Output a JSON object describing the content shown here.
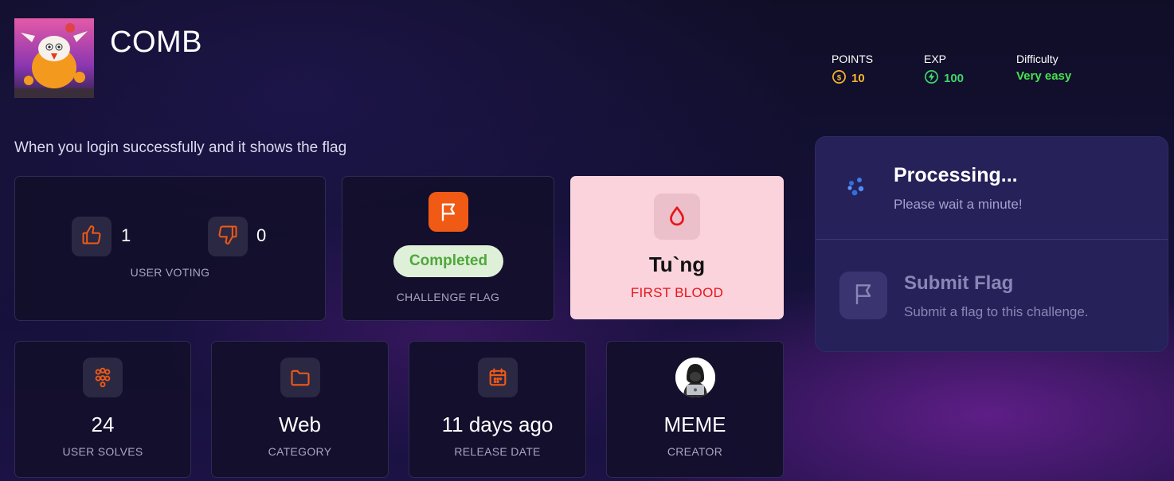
{
  "challenge": {
    "title": "COMB",
    "description": "When you login successfully and it shows the flag"
  },
  "stats": {
    "points_label": "POINTS",
    "points_value": "10",
    "exp_label": "EXP",
    "exp_value": "100",
    "difficulty_label": "Difficulty",
    "difficulty_value": "Very easy"
  },
  "voting": {
    "upvotes": "1",
    "downvotes": "0",
    "caption": "USER VOTING"
  },
  "flag": {
    "status": "Completed",
    "caption": "CHALLENGE FLAG"
  },
  "first_blood": {
    "name": "Tu`ng",
    "caption": "FIRST BLOOD"
  },
  "info_cards": {
    "solves_value": "24",
    "solves_caption": "USER SOLVES",
    "category_value": "Web",
    "category_caption": "CATEGORY",
    "release_value": "11 days ago",
    "release_caption": "RELEASE DATE",
    "creator_value": "MEME",
    "creator_caption": "CREATOR"
  },
  "panel": {
    "processing_title": "Processing...",
    "processing_sub": "Please wait a minute!",
    "submit_title": "Submit Flag",
    "submit_sub": "Submit a flag to this challenge."
  },
  "colors": {
    "accent_orange": "#f05a14",
    "points": "#f5b52e",
    "exp": "#3fd66a",
    "difficulty": "#47e04f",
    "first_blood_bg": "#fbd3dc",
    "first_blood_text": "#e8151c",
    "panel_bg": "#262159"
  },
  "icons": {
    "points": "coin-icon",
    "exp": "bolt-icon",
    "upvote": "thumbs-up-icon",
    "downvote": "thumbs-down-icon",
    "flag": "flag-icon",
    "blood": "drop-icon",
    "solves": "users-icon",
    "category": "folder-icon",
    "release": "calendar-icon",
    "processing": "spinner-icon",
    "submit": "flag-outline-icon"
  }
}
